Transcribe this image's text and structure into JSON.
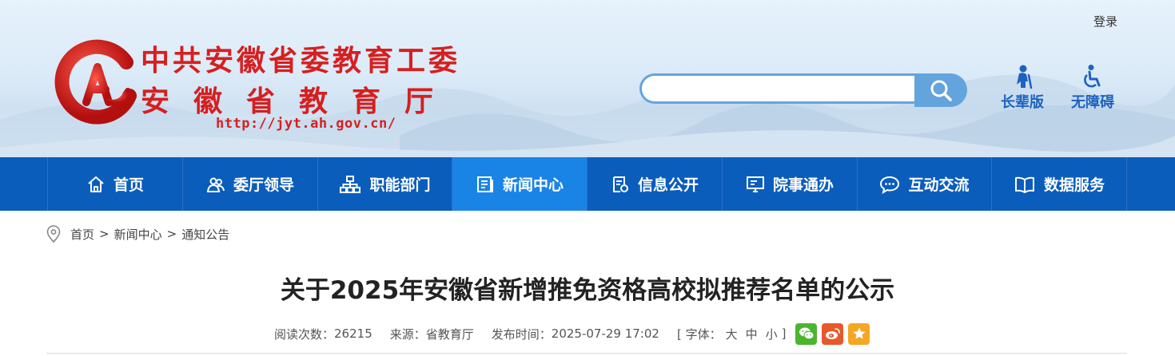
{
  "header": {
    "login_label": "登录",
    "title_line1": "中共安徽省委教育工委",
    "title_line2": "安徽省教育厅",
    "url": "http://jyt.ah.gov.cn/",
    "search_placeholder": "",
    "modes": [
      {
        "label": "长辈版",
        "icon": "elder-icon"
      },
      {
        "label": "无障碍",
        "icon": "wheelchair-icon"
      }
    ]
  },
  "nav": {
    "items": [
      {
        "label": "首页",
        "icon": "home-icon"
      },
      {
        "label": "委厅领导",
        "icon": "leaders-icon"
      },
      {
        "label": "职能部门",
        "icon": "org-chart-icon"
      },
      {
        "label": "新闻中心",
        "icon": "news-icon",
        "active": true
      },
      {
        "label": "信息公开",
        "icon": "info-icon"
      },
      {
        "label": "院事通办",
        "icon": "monitor-icon"
      },
      {
        "label": "互动交流",
        "icon": "chat-icon"
      },
      {
        "label": "数据服务",
        "icon": "book-icon"
      }
    ]
  },
  "breadcrumb": {
    "items": [
      "首页",
      "新闻中心",
      "通知公告"
    ],
    "separator": ">"
  },
  "article": {
    "title": "关于2025年安徽省新增推免资格高校拟推荐名单的公示",
    "views_label": "阅读次数：",
    "views": "26215",
    "source_label": "来源：",
    "source": "省教育厅",
    "date_label": "发布时间：",
    "date": "2025-07-29 17:02",
    "font_label": "[ 字体：",
    "font_large": "大",
    "font_medium": "中",
    "font_small": "小",
    "font_close": "]"
  },
  "share": {
    "wechat_color": "#4cb52f",
    "weibo_color": "#e8582c",
    "favorite_color": "#f5a623"
  },
  "colors": {
    "brand_red": "#d61f1f",
    "nav_blue": "#0b5dbc",
    "nav_active": "#1a84e6",
    "search_blue": "#64a4dd"
  }
}
